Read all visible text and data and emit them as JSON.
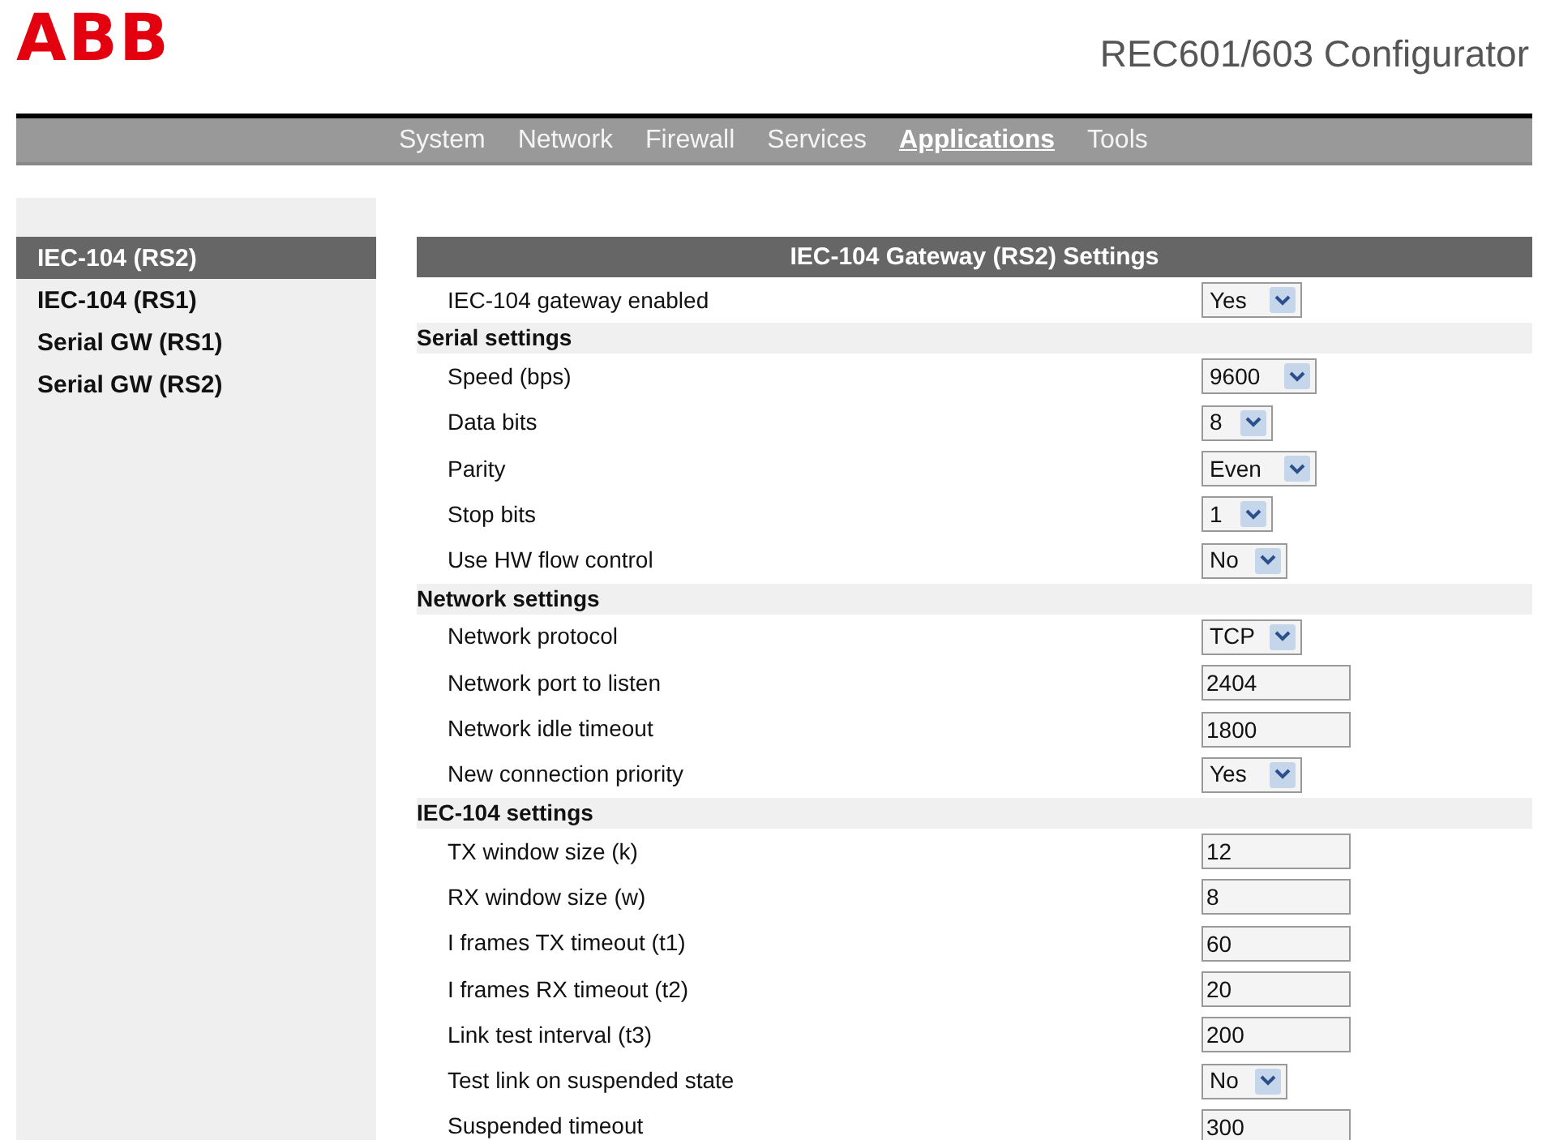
{
  "header": {
    "logo": "ABB",
    "title": "REC601/603 Configurator"
  },
  "nav": [
    {
      "label": "System",
      "selected": false
    },
    {
      "label": "Network",
      "selected": false
    },
    {
      "label": "Firewall",
      "selected": false
    },
    {
      "label": "Services",
      "selected": false
    },
    {
      "label": "Applications",
      "selected": true
    },
    {
      "label": "Tools",
      "selected": false
    }
  ],
  "sidebar": {
    "items": [
      {
        "label": "IEC-104 (RS2)",
        "selected": true
      },
      {
        "label": "IEC-104 (RS1)",
        "selected": false
      },
      {
        "label": "Serial GW (RS1)",
        "selected": false
      },
      {
        "label": "Serial GW (RS2)",
        "selected": false
      }
    ]
  },
  "panel": {
    "title": "IEC-104 Gateway (RS2) Settings",
    "rows": [
      {
        "kind": "select",
        "label": "IEC-104 gateway enabled",
        "value": "Yes"
      },
      {
        "kind": "section",
        "label": "Serial settings"
      },
      {
        "kind": "select",
        "label": "Speed (bps)",
        "value": "9600"
      },
      {
        "kind": "select",
        "label": "Data bits",
        "value": "8"
      },
      {
        "kind": "select",
        "label": "Parity",
        "value": "Even"
      },
      {
        "kind": "select",
        "label": "Stop bits",
        "value": "1"
      },
      {
        "kind": "select",
        "label": "Use HW flow control",
        "value": "No"
      },
      {
        "kind": "section",
        "label": "Network settings"
      },
      {
        "kind": "select",
        "label": "Network protocol",
        "value": "TCP"
      },
      {
        "kind": "input",
        "label": "Network port to listen",
        "value": "2404"
      },
      {
        "kind": "input",
        "label": "Network idle timeout",
        "value": "1800"
      },
      {
        "kind": "select",
        "label": "New connection priority",
        "value": "Yes"
      },
      {
        "kind": "section",
        "label": "IEC-104 settings"
      },
      {
        "kind": "input",
        "label": "TX window size (k)",
        "value": "12"
      },
      {
        "kind": "input",
        "label": "RX window size (w)",
        "value": "8"
      },
      {
        "kind": "input",
        "label": "I frames TX timeout (t1)",
        "value": "60"
      },
      {
        "kind": "input",
        "label": "I frames RX timeout (t2)",
        "value": "20"
      },
      {
        "kind": "input",
        "label": "Link test interval (t3)",
        "value": "200"
      },
      {
        "kind": "select",
        "label": "Test link on suspended state",
        "value": "No"
      },
      {
        "kind": "input",
        "label": "Suspended timeout",
        "value": "300"
      }
    ]
  }
}
